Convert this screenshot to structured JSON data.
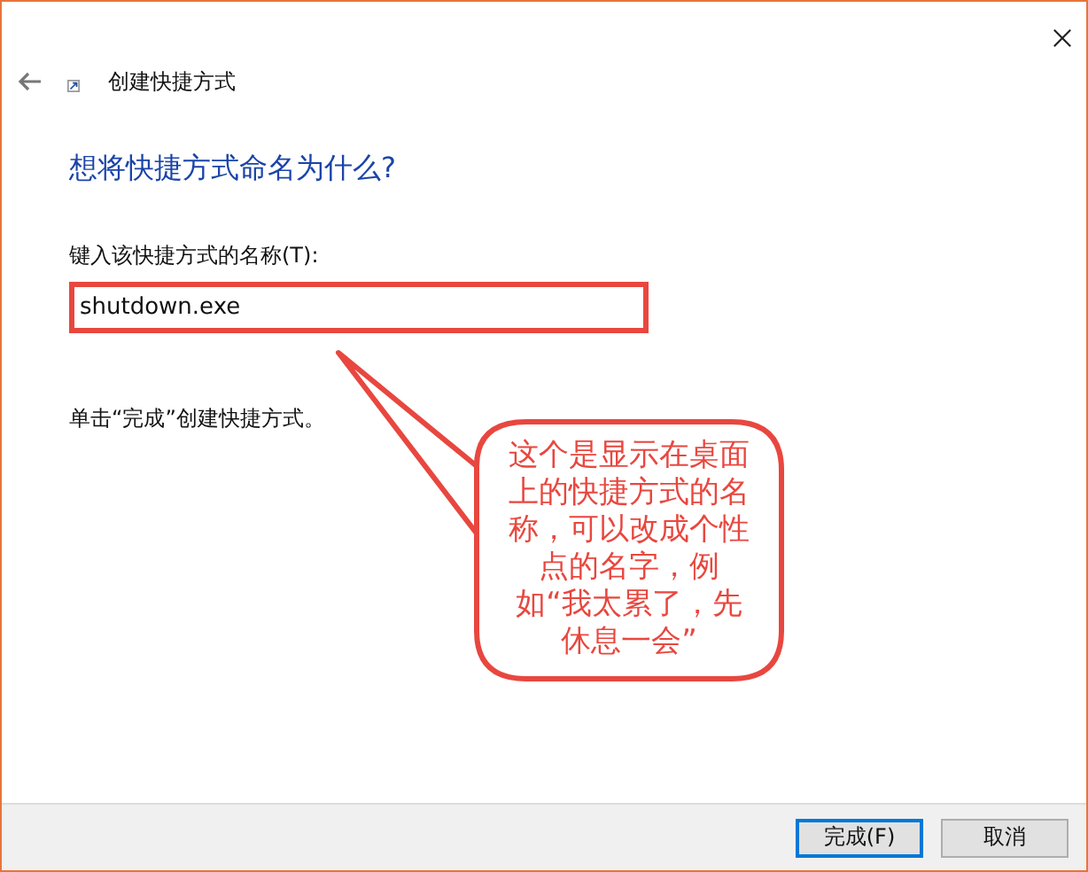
{
  "wizard": {
    "title": "创建快捷方式"
  },
  "heading": "想将快捷方式命名为什么?",
  "name_field": {
    "label": "键入该快捷方式的名称(T):",
    "value": "shutdown.exe"
  },
  "hint": "单击“完成”创建快捷方式。",
  "callout": {
    "text": "这个是显示在桌面上的快捷方式的名称，可以改成个性点的名字，例如“我太累了，先休息一会”"
  },
  "buttons": [
    {
      "label": "完成(F)",
      "default": true
    },
    {
      "label": "取消",
      "default": false
    }
  ]
}
